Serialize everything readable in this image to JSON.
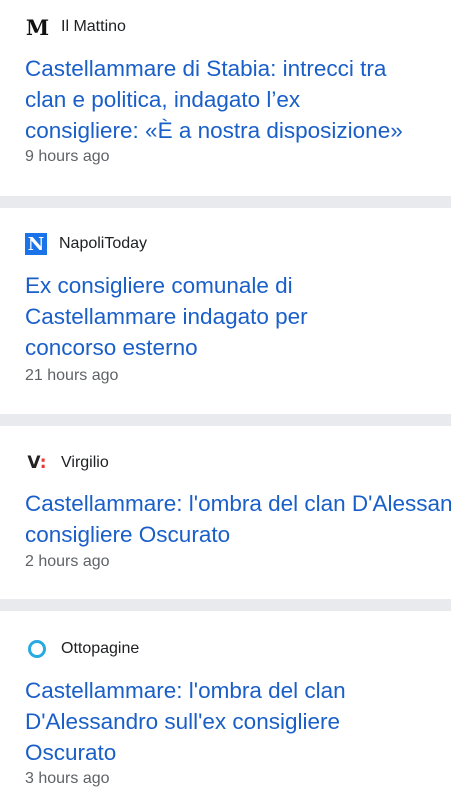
{
  "articles": [
    {
      "source": "Il Mattino",
      "logo_icon": "il-mattino-logo-icon",
      "logo_text": "M",
      "title_lines": [
        "Castellammare di Stabia: intrecci tra",
        "clan e politica, indagato l’ex",
        "consigliere: «È a nostra disposizione»"
      ],
      "time": "9 hours ago"
    },
    {
      "source": "NapoliToday",
      "logo_icon": "napolitoday-logo-icon",
      "logo_text": "N",
      "title_lines": [
        "Ex consigliere comunale di",
        "Castellammare indagato per",
        "concorso esterno"
      ],
      "time": "21 hours ago"
    },
    {
      "source": "Virgilio",
      "logo_icon": "virgilio-logo-icon",
      "logo_text": "V",
      "title_lines": [
        "Castellammare: l'ombra del clan D'Alessandro sull'ex",
        "consigliere Oscurato"
      ],
      "time": "2 hours ago"
    },
    {
      "source": "Ottopagine",
      "logo_icon": "ottopagine-ring-icon",
      "title_lines": [
        "Castellammare: l'ombra del clan",
        "D'Alessandro sull'ex consigliere",
        "Oscurato"
      ],
      "time": "3 hours ago"
    }
  ],
  "colors": {
    "title": "#1a5fc8",
    "separator": "#e8eaed",
    "napolitoday_badge": "#1a73e8",
    "ottopagine_ring": "#29a9e1"
  }
}
